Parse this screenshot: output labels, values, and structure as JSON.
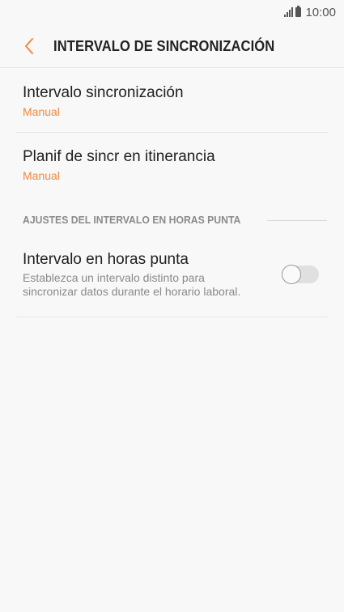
{
  "status_bar": {
    "time": "10:00",
    "signal_icon": "signal-icon",
    "battery_icon": "battery-icon"
  },
  "header": {
    "title": "INTERVALO DE SINCRONIZACIÓN",
    "back_icon": "chevron-left-icon"
  },
  "settings": [
    {
      "title": "Intervalo sincronización",
      "value": "Manual"
    },
    {
      "title": "Planif de sincr en itinerancia",
      "value": "Manual"
    }
  ],
  "peak_section": {
    "header": "AJUSTES DEL INTERVALO EN HORAS PUNTA",
    "item": {
      "title": "Intervalo en horas punta",
      "description_line1": "Establezca un intervalo distinto para",
      "description_line2": "sincronizar datos durante el horario laboral.",
      "toggle_on": false
    }
  },
  "colors": {
    "accent": "#f2893c",
    "background": "#f8f8f8",
    "secondary_text": "#8a8a8a"
  }
}
